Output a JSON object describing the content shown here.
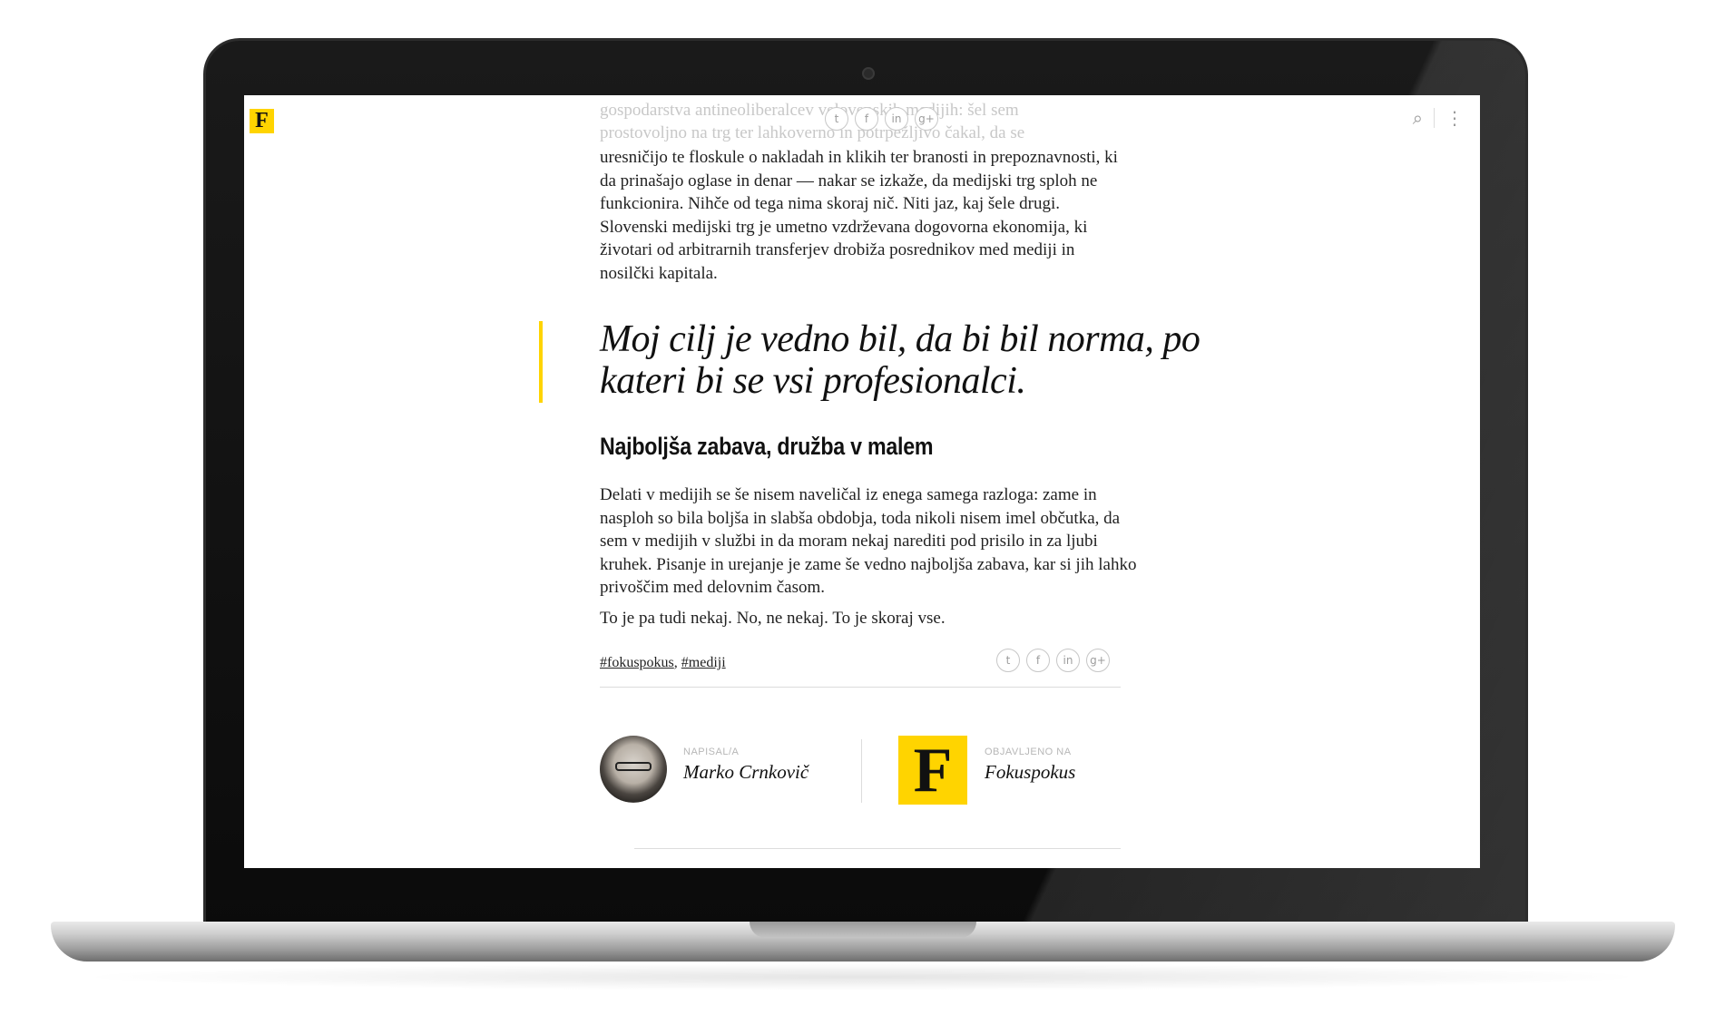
{
  "header": {
    "logo_letter": "F",
    "search_icon": "⌕",
    "menu_icon": "⋮"
  },
  "share_icons": [
    "twitter-icon",
    "facebook-icon",
    "linkedin-icon",
    "google-plus-icon"
  ],
  "share_glyphs": {
    "twitter": "t",
    "facebook": "f",
    "linkedin": "in",
    "googleplus": "g+"
  },
  "article": {
    "faded_lines": [
      "gospodarstva antineoliberalcev velovenskih medijih: šel sem",
      "prostovoljno na trg ter lahkoverno in potrpežljivo čakal, da se"
    ],
    "paragraph_1": "uresničijo te floskule o nakladah in klikih ter branosti in prepoznavnosti, ki da prinašajo oglase in denar — nakar se izkaže, da medijski trg sploh ne funkcionira. Nihče od tega nima skoraj nič. Niti jaz, kaj šele drugi. Slovenski medijski trg je umetno vzdrževana dogovorna ekonomija, ki životari od arbitrarnih transferjev drobiža posrednikov med mediji in nosilčki kapitala.",
    "pullquote": "Moj cilj je vedno bil, da bi bil norma, po kateri bi se vsi profesionalci.",
    "section_heading": "Najboljša zabava, družba v malem",
    "paragraph_2": "Delati v medijih se še nisem naveličal iz enega samega razloga: zame in nasploh so bila boljša in slabša obdobja, toda nikoli nisem imel občutka, da sem v medijih v službi in da moram nekaj narediti pod prisilo in za ljubi kruhek. Pisanje in urejanje je zame še vedno najboljša zabava, kar si jih lahko privoščim med delovnim časom.",
    "paragraph_3": "To je pa tudi nekaj. No, ne nekaj. To je skoraj vse."
  },
  "tags": {
    "tag_1": "#fokuspokus",
    "separator": ", ",
    "tag_2": "#mediji"
  },
  "author": {
    "label": "NAPISAL/A",
    "name": "Marko Crnkovič"
  },
  "publisher": {
    "label": "OBJAVLJENO NA",
    "name": "Fokuspokus",
    "logo_letter": "F"
  },
  "colors": {
    "accent": "#ffd400",
    "text": "#222222",
    "muted": "#b7b7b7"
  }
}
